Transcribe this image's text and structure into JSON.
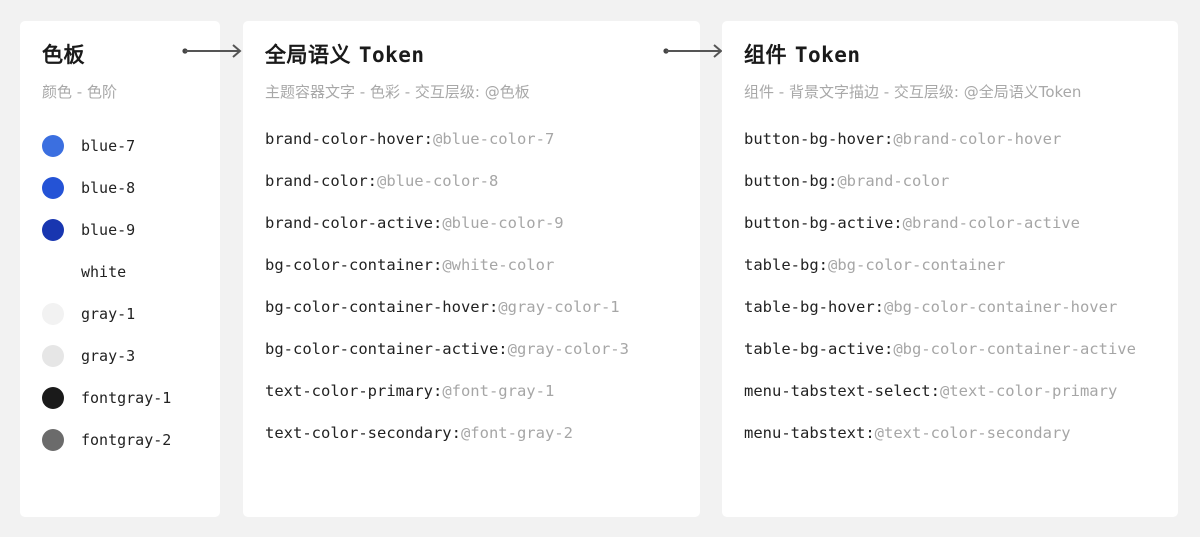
{
  "palette": {
    "title": "色板",
    "subtitle": "颜色 - 色阶",
    "swatches": [
      {
        "label": "blue-7",
        "color": "#3b6fe0"
      },
      {
        "label": "blue-8",
        "color": "#2453d6"
      },
      {
        "label": "blue-9",
        "color": "#1836b0"
      },
      {
        "label": "white",
        "color": "#ffffff"
      },
      {
        "label": "gray-1",
        "color": "#f2f2f2"
      },
      {
        "label": "gray-3",
        "color": "#e6e6e6"
      },
      {
        "label": "fontgray-1",
        "color": "#1a1a1a"
      },
      {
        "label": "fontgray-2",
        "color": "#6b6b6b"
      }
    ]
  },
  "global_tokens": {
    "title_cn": "全局语义",
    "title_en": "Token",
    "subtitle": "主题容器文字 - 色彩 - 交互层级: @色板",
    "items": [
      {
        "key": "brand-color-hover:",
        "ref": "@blue-color-7"
      },
      {
        "key": "brand-color:",
        "ref": "@blue-color-8"
      },
      {
        "key": "brand-color-active:",
        "ref": "@blue-color-9"
      },
      {
        "key": "bg-color-container:",
        "ref": "@white-color"
      },
      {
        "key": "bg-color-container-hover:",
        "ref": "@gray-color-1"
      },
      {
        "key": "bg-color-container-active:",
        "ref": "@gray-color-3"
      },
      {
        "key": "text-color-primary:",
        "ref": "@font-gray-1"
      },
      {
        "key": "text-color-secondary:",
        "ref": "@font-gray-2"
      }
    ]
  },
  "component_tokens": {
    "title_cn": "组件",
    "title_en": "Token",
    "subtitle": "组件 - 背景文字描边 - 交互层级: @全局语义Token",
    "items": [
      {
        "key": "button-bg-hover:",
        "ref": "@brand-color-hover"
      },
      {
        "key": "button-bg:",
        "ref": "@brand-color"
      },
      {
        "key": "button-bg-active:",
        "ref": "@brand-color-active"
      },
      {
        "key": "table-bg:",
        "ref": "@bg-color-container"
      },
      {
        "key": "table-bg-hover:",
        "ref": "@bg-color-container-hover"
      },
      {
        "key": "table-bg-active:",
        "ref": "@bg-color-container-active"
      },
      {
        "key": "menu-tabstext-select:",
        "ref": "@text-color-primary"
      },
      {
        "key": "menu-tabstext:",
        "ref": "@text-color-secondary"
      }
    ]
  },
  "arrows": [
    {
      "from": "palette",
      "to": "global_tokens"
    },
    {
      "from": "global_tokens",
      "to": "component_tokens"
    }
  ]
}
